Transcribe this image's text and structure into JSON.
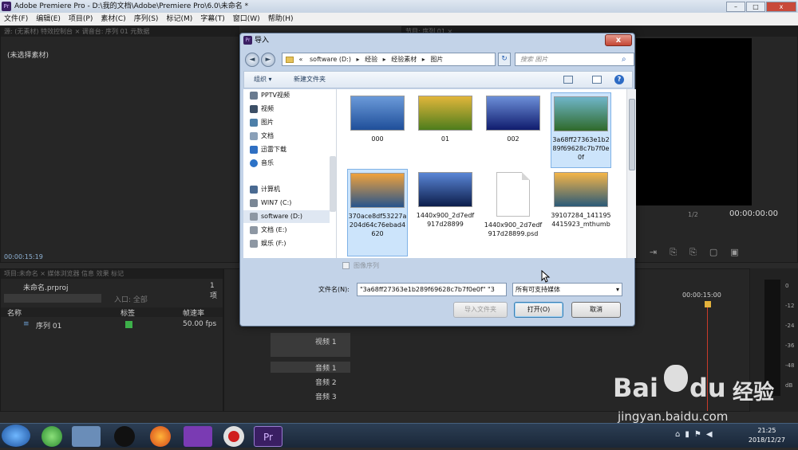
{
  "app": {
    "title": "Adobe Premiere Pro - D:\\我的文档\\Adobe\\Premiere Pro\\6.0\\未命名 *",
    "icon_label": "Pr",
    "menu": [
      "文件(F)",
      "编辑(E)",
      "项目(P)",
      "素材(C)",
      "序列(S)",
      "标记(M)",
      "字幕(T)",
      "窗口(W)",
      "帮助(H)"
    ]
  },
  "panels": {
    "source_tabs": "源: (无素材)    特效控制台 ×    调音台: 序列 01    元数据",
    "source_empty": "(未选择素材)",
    "source_timecode": "00:00:15:19",
    "program_tab": "节目: 序列 01 ×",
    "program_timecode": "00:00:00:00",
    "program_fraction": "1/2",
    "project_tabs": "项目:未命名 ×  媒体浏览器  信息  效果  标记",
    "project_file": "未命名.prproj",
    "project_count": "1 项",
    "in_label": "入口: 全部",
    "columns": [
      "名称",
      "标签",
      "帧速率"
    ],
    "sequence_name": "序列 01",
    "sequence_fps": "50.00 fps",
    "sequence_label_color": "#3db04a",
    "timeline_time": "00:00:15:00",
    "tracks": [
      "视频 1",
      "音频 1",
      "音频 2",
      "音频 3"
    ],
    "meter_scale": [
      "0",
      "-12",
      "-24",
      "-36",
      "-48",
      "dB"
    ]
  },
  "dialog": {
    "title": "导入",
    "icon_label": "Pr",
    "close_glyph": "x",
    "back_glyph": "◄",
    "forward_glyph": "►",
    "refresh_glyph": "↻",
    "address_prefix": "«",
    "breadcrumb": [
      "software (D:)",
      "经验",
      "经验素材",
      "图片"
    ],
    "separator": "▸",
    "search_placeholder": "搜索 图片",
    "toolbar": {
      "organize": "组织 ▾",
      "new_folder": "新建文件夹",
      "help": "?"
    },
    "nav_items": [
      {
        "label": "PPTV视频",
        "icon": "video-folder-icon",
        "color": "#6a7b8f"
      },
      {
        "label": "视频",
        "icon": "video-library-icon",
        "color": "#3c4f66"
      },
      {
        "label": "图片",
        "icon": "picture-library-icon",
        "color": "#4d7fa8"
      },
      {
        "label": "文档",
        "icon": "document-library-icon",
        "color": "#8aa0b8"
      },
      {
        "label": "迅雷下载",
        "icon": "download-folder-icon",
        "color": "#2f6fc2"
      },
      {
        "label": "音乐",
        "icon": "music-library-icon",
        "color": "#2c72c7"
      },
      {
        "label": "计算机",
        "icon": "computer-icon",
        "color": "#4a6a91"
      },
      {
        "label": "WIN7 (C:)",
        "icon": "system-drive-icon",
        "color": "#7a8795"
      },
      {
        "label": "software (D:)",
        "icon": "drive-icon",
        "color": "#8d97a3"
      },
      {
        "label": "文档 (E:)",
        "icon": "drive-icon",
        "color": "#8d97a3"
      },
      {
        "label": "娱乐 (F:)",
        "icon": "drive-icon",
        "color": "#8d97a3"
      }
    ],
    "files": [
      {
        "name": "000",
        "kind": "image",
        "c1": "#6b9ad9",
        "c2": "#1f4f9a"
      },
      {
        "name": "01",
        "kind": "image",
        "c1": "#e2b63b",
        "c2": "#4d7d1c"
      },
      {
        "name": "002",
        "kind": "image",
        "c1": "#6c8fd8",
        "c2": "#101c6e"
      },
      {
        "name": "3a68ff27363e1b289f69628c7b7f0e0f",
        "kind": "image",
        "c1": "#6fb5c9",
        "c2": "#2f6a2a",
        "selected": true
      },
      {
        "name": "370ace8df53227a204d64c76ebad4620",
        "kind": "image",
        "c1": "#f0a23c",
        "c2": "#26548d",
        "selected": true
      },
      {
        "name": "1440x900_2d7edf917d28899",
        "kind": "image",
        "c1": "#5a86d6",
        "c2": "#0c1d4b"
      },
      {
        "name": "1440x900_2d7edf917d28899.psd",
        "kind": "document"
      },
      {
        "name": "39107284_1411954415923_mthumb",
        "kind": "image",
        "c1": "#f5b548",
        "c2": "#2b5a78"
      }
    ],
    "image_sequence_label": "图像序列",
    "filename_label": "文件名(N):",
    "filename_value": "\"3a68ff27363e1b289f69628c7b7f0e0f\" \"3",
    "filter_value": "所有可支持媒体",
    "buttons": {
      "import_folder": "导入文件夹",
      "open": "打开(O)",
      "cancel": "取消"
    }
  },
  "taskbar": {
    "time": "21:25",
    "date": "2018/12/27",
    "pr_label": "Pr"
  },
  "watermark": {
    "brand": "Bai",
    "brand2": "du",
    "jy": "经验",
    "url": "jingyan.baidu.com"
  }
}
